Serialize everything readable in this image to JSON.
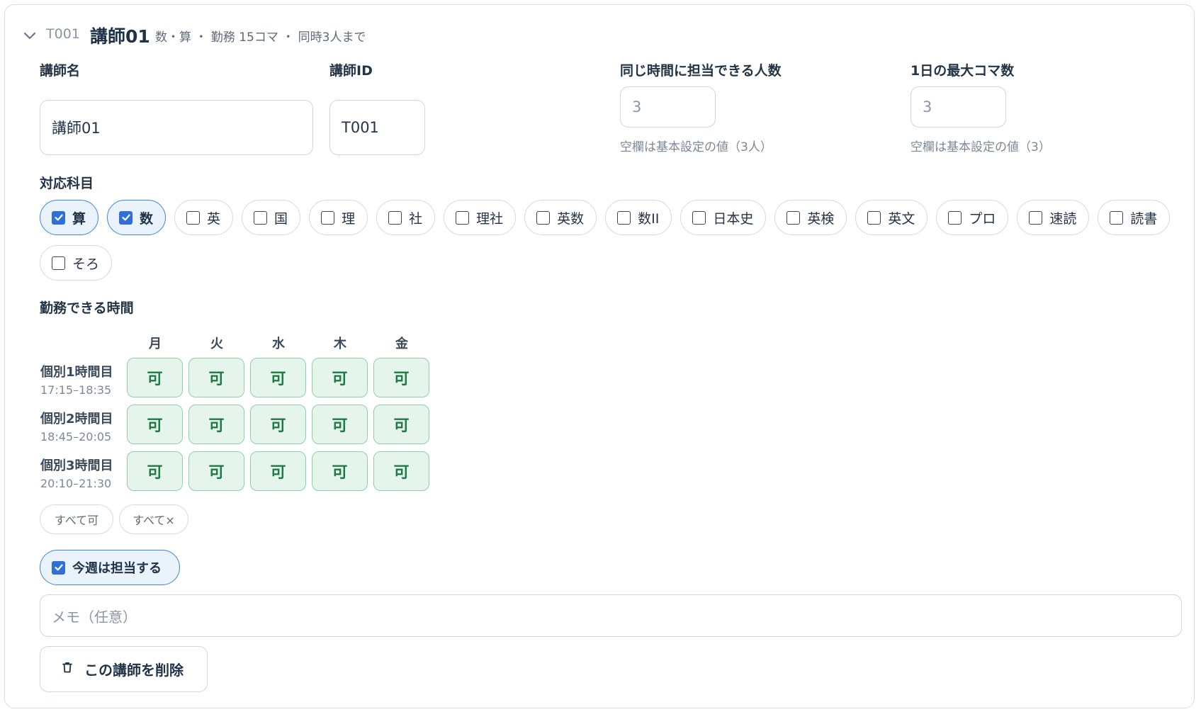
{
  "header": {
    "id": "T001",
    "name": "講師01",
    "meta": "数・算 ・ 勤務 15コマ ・ 同時3人まで"
  },
  "form": {
    "name_label": "講師名",
    "name_value": "講師01",
    "id_label": "講師ID",
    "id_value": "T001",
    "concurrent_label": "同じ時間に担当できる人数",
    "concurrent_placeholder": "3",
    "concurrent_hint": "空欄は基本設定の値（3人）",
    "maxslots_label": "1日の最大コマ数",
    "maxslots_placeholder": "3",
    "maxslots_hint": "空欄は基本設定の値（3）"
  },
  "subjects": {
    "label": "対応科目",
    "items": [
      {
        "label": "算",
        "checked": true
      },
      {
        "label": "数",
        "checked": true
      },
      {
        "label": "英",
        "checked": false
      },
      {
        "label": "国",
        "checked": false
      },
      {
        "label": "理",
        "checked": false
      },
      {
        "label": "社",
        "checked": false
      },
      {
        "label": "理社",
        "checked": false
      },
      {
        "label": "英数",
        "checked": false
      },
      {
        "label": "数II",
        "checked": false
      },
      {
        "label": "日本史",
        "checked": false
      },
      {
        "label": "英検",
        "checked": false
      },
      {
        "label": "英文",
        "checked": false
      },
      {
        "label": "プロ",
        "checked": false
      },
      {
        "label": "速読",
        "checked": false
      },
      {
        "label": "読書",
        "checked": false
      },
      {
        "label": "そろ",
        "checked": false
      }
    ]
  },
  "schedule": {
    "label": "勤務できる時間",
    "days": [
      "月",
      "火",
      "水",
      "木",
      "金"
    ],
    "rows": [
      {
        "name": "個別1時間目",
        "time": "17:15–18:35",
        "cells": [
          "可",
          "可",
          "可",
          "可",
          "可"
        ]
      },
      {
        "name": "個別2時間目",
        "time": "18:45–20:05",
        "cells": [
          "可",
          "可",
          "可",
          "可",
          "可"
        ]
      },
      {
        "name": "個別3時間目",
        "time": "20:10–21:30",
        "cells": [
          "可",
          "可",
          "可",
          "可",
          "可"
        ]
      }
    ],
    "all_ok_label": "すべて可",
    "all_ng_label": "すべて×"
  },
  "assign": {
    "label": "今週は担当する",
    "checked": true
  },
  "memo": {
    "placeholder": "メモ（任意）"
  },
  "delete_label": "この講師を削除",
  "colors": {
    "accent": "#2f6fd6",
    "available_bg": "#e6f5ec",
    "available_text": "#1f7a45",
    "chip_selected_bg": "#eaf2fc"
  }
}
